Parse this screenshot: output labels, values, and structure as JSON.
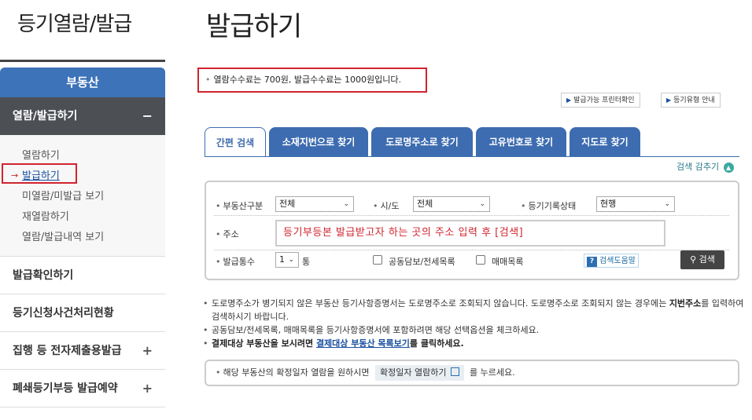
{
  "sidebar": {
    "brand": "등기열람/발급",
    "category": "부동산",
    "section": "열람/발급하기",
    "section_toggle": "−",
    "sub_items": [
      "열람하기",
      "발급하기",
      "미열람/미발급 보기",
      "재열람하기",
      "열람/발급내역 보기"
    ],
    "active_arrow": "→",
    "menu": [
      {
        "label": "발급확인하기",
        "toggle": ""
      },
      {
        "label": "등기신청사건처리현황",
        "toggle": ""
      },
      {
        "label": "집행 등 전자제출용발급",
        "toggle": "+"
      },
      {
        "label": "폐쇄등기부등 발급예약",
        "toggle": "+"
      }
    ]
  },
  "main": {
    "title": "발급하기",
    "fee_notice": "열람수수료는 700원, 발급수수료는 1000원입니다.",
    "top_buttons": [
      "발급가능 프린터확인",
      "등기유형 안내"
    ],
    "tabs": [
      "간편 검색",
      "소재지번으로 찾기",
      "도로명주소로 찾기",
      "고유번호로 찾기",
      "지도로 찾기"
    ],
    "collapse_label": "검색 감추기",
    "search": {
      "property_type_label": "부동산구분",
      "property_type_value": "전체",
      "region_label": "시/도",
      "region_value": "전체",
      "record_status_label": "등기기록상태",
      "record_status_value": "현행",
      "address_label": "주소",
      "address_value": "등기부등본 발급받고자 하는 곳의 주소 입력 후 [검색]",
      "copies_label": "발급통수",
      "copies_value": "1",
      "copies_unit": "통",
      "option1": "공동담보/전세목록",
      "option2": "매매목록",
      "help_label": "검색도움말",
      "search_button": "검색"
    },
    "notes": {
      "n1_a": "도로명주소가 병기되지 않은 부동산 등기사항증명서는 도로명주소로 조회되지 않습니다. 도로명주소로 조회되지 않는 경우에는 ",
      "n1_b": "지번주소",
      "n1_c": "를 입력하여 검색하시기 바랍니다.",
      "n2": "공동담보/전세목록, 매매목록을 등기사항증명서에 포함하려면 해당 선택옵션을 체크하세요.",
      "n3_a": "결제대상 부동산을 보시려면 ",
      "n3_link": "결제대상 부동산 목록보기",
      "n3_b": "를 클릭하세요."
    },
    "info": {
      "text_a": "해당 부동산의 확정일자 열람을 원하시면",
      "button": "확정일자 열람하기",
      "text_b": "를 누르세요."
    }
  }
}
